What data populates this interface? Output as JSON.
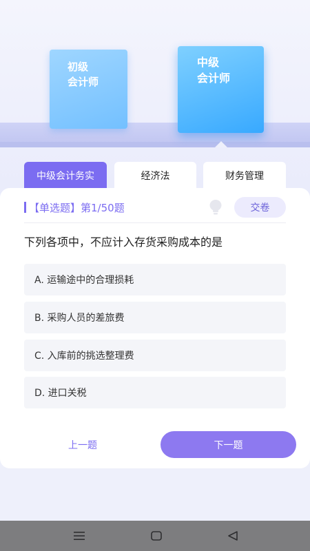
{
  "levels": {
    "junior": {
      "line1": "初级",
      "line2": "会计师"
    },
    "intermediate": {
      "line1": "中级",
      "line2": "会计师"
    }
  },
  "tabs": [
    {
      "label": "中级会计务实",
      "active": true
    },
    {
      "label": "经济法",
      "active": false
    },
    {
      "label": "财务管理",
      "active": false
    }
  ],
  "question_header": {
    "type": "【单选题】",
    "progress": "第1/50题"
  },
  "submit_label": "交卷",
  "question_text": "下列各项中，不应计入存货采购成本的是",
  "options": [
    {
      "text": "A. 运输途中的合理损耗"
    },
    {
      "text": "B. 采购人员的差旅费"
    },
    {
      "text": "C. 入库前的挑选整理费"
    },
    {
      "text": "D. 进口关税"
    }
  ],
  "nav": {
    "prev_label": "上一题",
    "next_label": "下一题"
  },
  "colors": {
    "accent": "#7b6cf1",
    "next_button": "#8d79f0",
    "card_blue": "#38a9ff"
  },
  "icons": {
    "hint": "lightbulb-icon",
    "system_nav": [
      "menu-icon",
      "home-icon",
      "back-icon"
    ]
  }
}
